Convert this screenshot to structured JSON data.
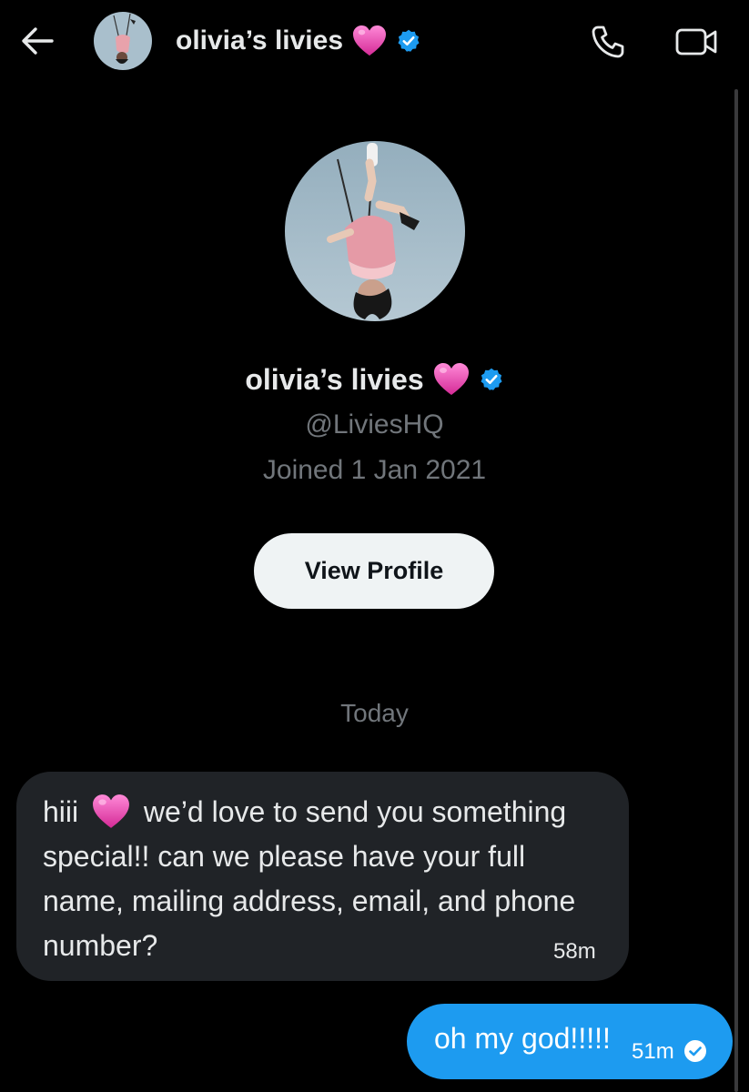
{
  "header": {
    "back_icon": "arrow-left-icon",
    "title": "olivia’s livies",
    "title_emoji": "pink-heart",
    "verified_icon": "verified-badge-icon",
    "call_icon": "phone-icon",
    "video_icon": "video-camera-icon"
  },
  "profile": {
    "name": "olivia’s livies",
    "handle": "@LiviesHQ",
    "joined": "Joined 1 Jan 2021",
    "view_profile_label": "View Profile"
  },
  "conversation": {
    "date_separator": "Today",
    "messages": [
      {
        "direction": "incoming",
        "text_before_emoji": "hiii",
        "text_after_emoji": "we’d love to send you something special!! can we please have your full name, mailing address, email, and phone number?",
        "time": "58m"
      },
      {
        "direction": "outgoing",
        "text": "oh my god!!!!!",
        "time": "51m",
        "status_icon": "read-check-icon"
      }
    ]
  },
  "colors": {
    "background": "#000000",
    "incoming_bubble": "#202327",
    "outgoing_bubble": "#1d9bf0",
    "verified": "#1d9bf0",
    "secondary_text": "#71767b",
    "heart": "#e83aa8"
  }
}
